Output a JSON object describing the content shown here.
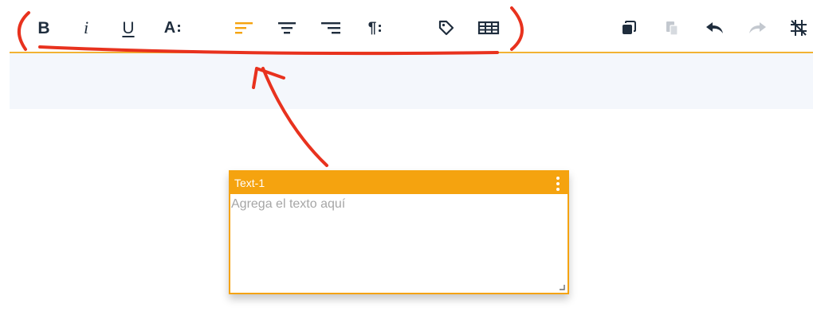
{
  "toolbar": {
    "buttons": [
      {
        "id": "bold",
        "glyph": "B",
        "icon": "bold-icon"
      },
      {
        "id": "italic",
        "glyph": "i",
        "icon": "italic-icon"
      },
      {
        "id": "underline",
        "glyph": "U",
        "icon": "underline-icon"
      },
      {
        "id": "font",
        "glyph": "A",
        "icon": "font-size-icon"
      },
      {
        "id": "align-left",
        "icon": "align-left-icon",
        "active": true
      },
      {
        "id": "align-center",
        "icon": "align-center-icon"
      },
      {
        "id": "align-right",
        "icon": "align-right-icon"
      },
      {
        "id": "paragraph",
        "glyph": "¶",
        "icon": "paragraph-icon"
      },
      {
        "id": "tag",
        "icon": "tag-icon"
      },
      {
        "id": "table",
        "icon": "table-icon"
      },
      {
        "id": "duplicate",
        "icon": "duplicate-icon"
      },
      {
        "id": "paste",
        "icon": "paste-icon",
        "disabled": true
      },
      {
        "id": "undo",
        "icon": "undo-icon"
      },
      {
        "id": "redo",
        "icon": "redo-icon",
        "disabled": true
      },
      {
        "id": "grid-off",
        "icon": "grid-off-icon"
      }
    ]
  },
  "textbox": {
    "title": "Text-1",
    "placeholder": "Agrega el texto aquí",
    "value": ""
  },
  "colors": {
    "accent": "#f5a30f",
    "icon": "#1f2d3d",
    "icon_disabled": "#c3c8cf",
    "annotation": "#e8321e",
    "band": "#f4f7fc"
  }
}
